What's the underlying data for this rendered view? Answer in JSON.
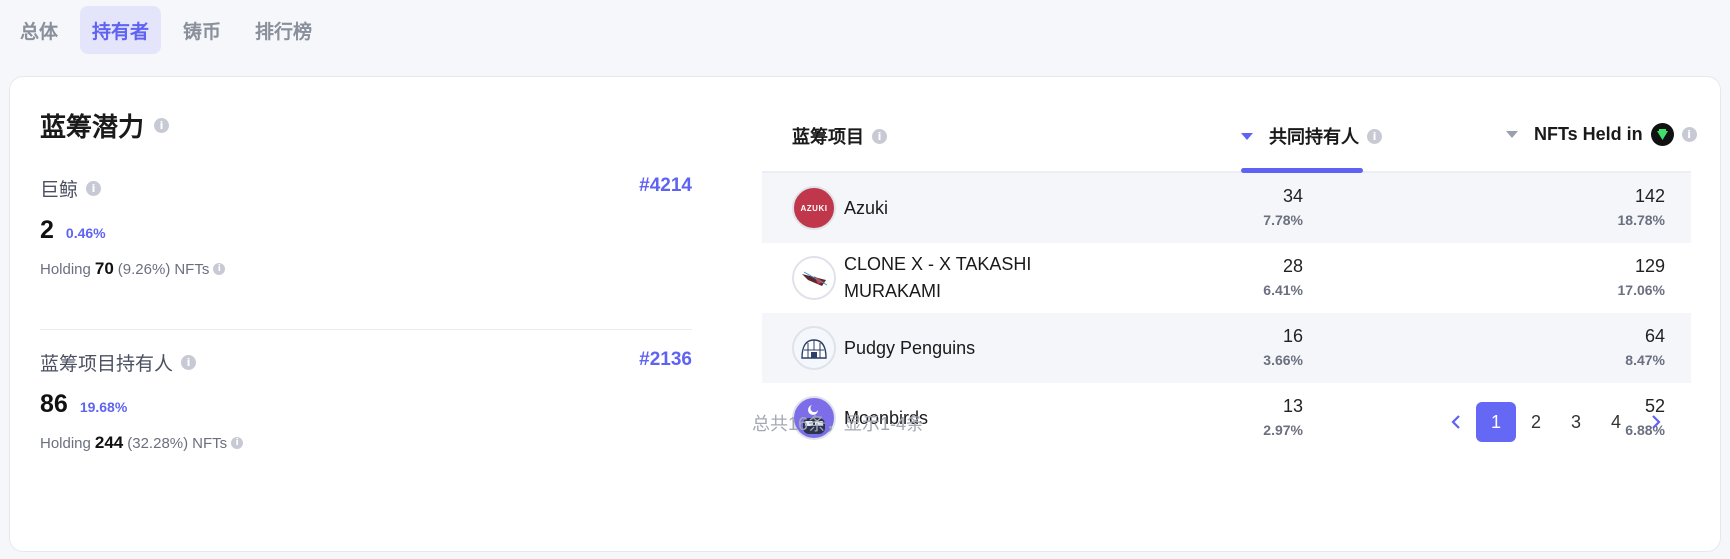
{
  "tabs": [
    {
      "label": "总体",
      "active": false
    },
    {
      "label": "持有者",
      "active": true
    },
    {
      "label": "铸币",
      "active": false
    },
    {
      "label": "排行榜",
      "active": false
    }
  ],
  "blue_chip": {
    "title": "蓝筹潜力",
    "whale": {
      "label": "巨鲸",
      "rank": "#4214",
      "value": "2",
      "percent": "0.46%",
      "holding_prefix": "Holding",
      "holding_count": "70",
      "holding_percent": "(9.26%)",
      "holding_suffix": "NFTs"
    },
    "holders": {
      "label": "蓝筹项目持有人",
      "rank": "#2136",
      "value": "86",
      "percent": "19.68%",
      "holding_prefix": "Holding",
      "holding_count": "244",
      "holding_percent": "(32.28%)",
      "holding_suffix": "NFTs"
    }
  },
  "table": {
    "headers": {
      "project": "蓝筹项目",
      "common_holders": "共同持有人",
      "nfts_held": "NFTs Held in"
    },
    "rows": [
      {
        "name": "Azuki",
        "avatar_text": "AZUKI",
        "common": "34",
        "common_pct": "7.78%",
        "held": "142",
        "held_pct": "18.78%"
      },
      {
        "name": "CLONE X - X TAKASHI MURAKAMI",
        "common": "28",
        "common_pct": "6.41%",
        "held": "129",
        "held_pct": "17.06%"
      },
      {
        "name": "Pudgy Penguins",
        "common": "16",
        "common_pct": "3.66%",
        "held": "64",
        "held_pct": "8.47%"
      },
      {
        "name": "Moonbirds",
        "common": "13",
        "common_pct": "2.97%",
        "held": "52",
        "held_pct": "6.88%"
      }
    ],
    "footer": "总共16条，显示1-4条",
    "pages": [
      "1",
      "2",
      "3",
      "4"
    ],
    "current_page": "1"
  },
  "colors": {
    "accent": "#5f63f2",
    "tab_active_bg": "#e4e5fb",
    "azuki_red": "#c0364a"
  },
  "icons": {
    "info": "info-icon",
    "sort_caret": "caret-down-icon",
    "prev": "chevron-left-icon",
    "next": "chevron-right-icon",
    "collection_badge": "collection-badge-icon"
  }
}
